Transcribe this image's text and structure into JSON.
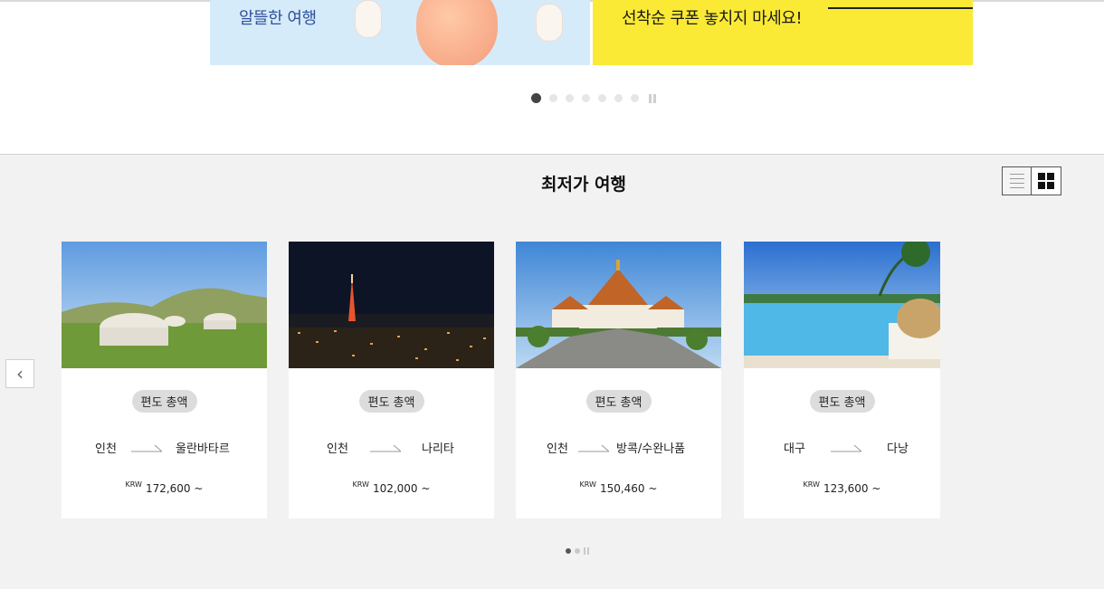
{
  "banner": {
    "left_text": "알뜰한 여행",
    "right_text": "선착순 쿠폰 놓치지 마세요!"
  },
  "section": {
    "title": "최저가 여행",
    "view_list_icon": "list-view-icon",
    "view_grid_icon": "grid-view-icon",
    "prev_icon": "chevron-left-icon"
  },
  "cards": [
    {
      "badge": "편도 총액",
      "from": "인천",
      "to": "울란바타르",
      "currency": "KRW",
      "price": "172,600 ~"
    },
    {
      "badge": "편도 총액",
      "from": "인천",
      "to": "나리타",
      "currency": "KRW",
      "price": "102,000 ~"
    },
    {
      "badge": "편도 총액",
      "from": "인천",
      "to": "방콕/수완나품",
      "currency": "KRW",
      "price": "150,460 ~"
    },
    {
      "badge": "편도 총액",
      "from": "대구",
      "to": "다낭",
      "currency": "KRW",
      "price": "123,600 ~"
    }
  ],
  "colors": {
    "banner_left_bg": "#d6ebfa",
    "banner_right_bg": "#fbea35",
    "section_bg": "#f2f2f2"
  }
}
